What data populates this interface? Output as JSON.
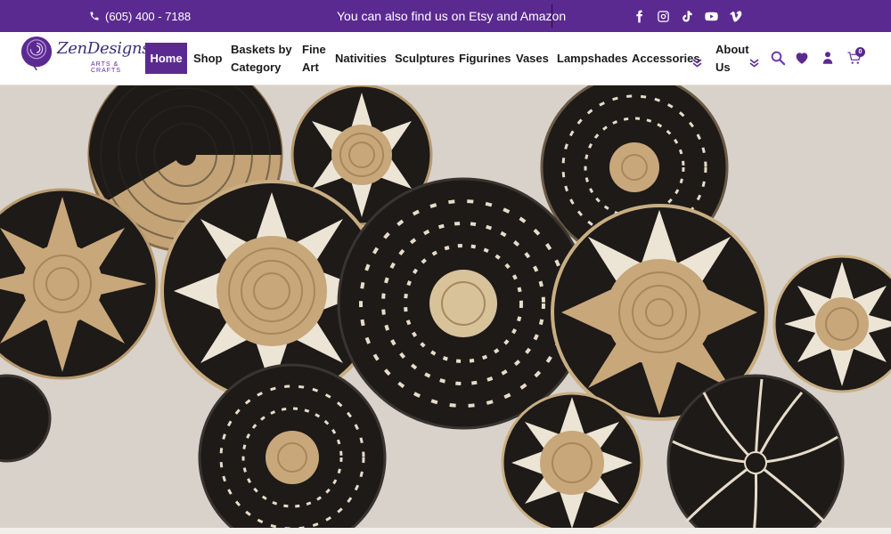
{
  "topbar": {
    "phone": "(605) 400 - 7188",
    "promo": "You can also find us on Etsy and Amazon",
    "social_icons": [
      "facebook-icon",
      "instagram-icon",
      "tiktok-icon",
      "youtube-icon",
      "vimeo-icon"
    ]
  },
  "brand": {
    "name": "ZenDesigns",
    "tagline": "ARTS & CRAFTS"
  },
  "nav": {
    "items": [
      {
        "label": "Home",
        "active": true
      },
      {
        "label": "Shop"
      },
      {
        "label": "Baskets by Category"
      },
      {
        "label": "Fine Art"
      },
      {
        "label": "Nativities"
      },
      {
        "label": "Sculptures"
      },
      {
        "label": "Figurines"
      },
      {
        "label": "Vases"
      },
      {
        "label": "Lampshades"
      },
      {
        "label": "Accessories",
        "dropdown": true
      },
      {
        "label": "About Us",
        "dropdown": true
      }
    ],
    "icons": [
      "search-icon",
      "heart-icon",
      "user-icon",
      "cart-icon"
    ],
    "cart_count": "0"
  },
  "hero": {
    "image": "woven-baskets-wall-icon"
  },
  "colors": {
    "brand_purple": "#5b2a91",
    "wall": "#d8d2cb",
    "basket_dark": "#1d1a18",
    "basket_tan": "#c8a77a",
    "basket_cream": "#ece5d6"
  }
}
